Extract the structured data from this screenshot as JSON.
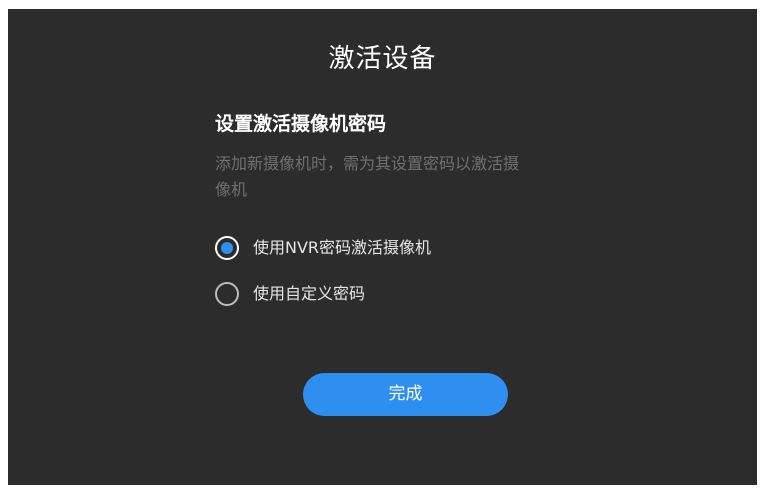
{
  "dialog": {
    "title": "激活设备",
    "subtitle": "设置激活摄像机密码",
    "description_line1": "添加新摄像机时，需为其设置密码以激活摄",
    "description_line2": "像机",
    "options": [
      {
        "label": "使用NVR密码激活摄像机",
        "selected": true
      },
      {
        "label": "使用自定义密码",
        "selected": false
      }
    ],
    "done_label": "完成"
  },
  "colors": {
    "background": "#2c2c2c",
    "accent": "#2f8ff0",
    "description_text": "#707070"
  }
}
